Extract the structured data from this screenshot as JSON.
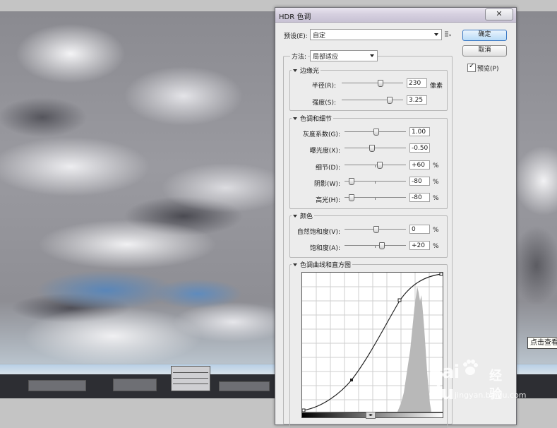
{
  "dialog": {
    "title": "HDR 色调",
    "close": "✕",
    "preset_label": "预设(E):",
    "preset_value": "自定",
    "ok_label": "确定",
    "cancel_label": "取消",
    "preview_label": "预览(P)",
    "preview_checked": "✓",
    "method_label": "方法:",
    "method_value": "局部适应"
  },
  "edge_glow": {
    "title": "边缘光",
    "radius_label": "半径(R):",
    "radius_value": "230",
    "radius_unit": "像素",
    "radius_level": 0.62,
    "strength_label": "强度(S):",
    "strength_value": "3.25",
    "strength_level": 0.77
  },
  "tone_detail": {
    "title": "色调和细节",
    "gamma_label": "灰度系数(G):",
    "gamma_value": "1.00",
    "gamma_level": 0.5,
    "exposure_label": "曝光度(X):",
    "exposure_value": "-0.50",
    "exposure_level": 0.44,
    "detail_label": "细节(D):",
    "detail_value": "+60",
    "detail_level": 0.56,
    "shadow_label": "阴影(W):",
    "shadow_value": "-80",
    "shadow_level": 0.1,
    "highlight_label": "高光(H):",
    "highlight_value": "-80",
    "highlight_level": 0.1,
    "pct": "%"
  },
  "color": {
    "title": "颜色",
    "vibrance_label": "自然饱和度(V):",
    "vibrance_value": "0",
    "vibrance_level": 0.5,
    "saturation_label": "饱和度(A):",
    "saturation_value": "+20",
    "saturation_level": 0.6,
    "pct": "%"
  },
  "curve": {
    "title": "色调曲线和直方图"
  },
  "tooltip": "点击查看",
  "watermark": {
    "logo": "Bai  du",
    "cn": "经验",
    "url": "jingyan.baidu.com"
  }
}
